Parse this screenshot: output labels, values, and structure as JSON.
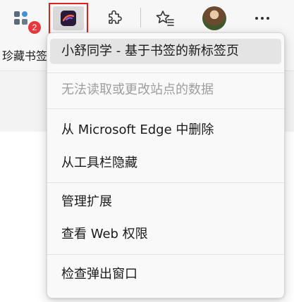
{
  "toolbar": {
    "apps_badge": "2",
    "accent": "#e02020"
  },
  "favorites_bar": {
    "item_label": "珍藏书签"
  },
  "menu": {
    "title": "小舒同学 - 基于书签的新标签页",
    "read_change_site_data": "无法读取或更改站点的数据",
    "remove_from_edge": "从 Microsoft Edge 中删除",
    "hide_from_toolbar": "从工具栏隐藏",
    "manage_extensions": "管理扩展",
    "view_web_permissions": "查看 Web 权限",
    "inspect_popup": "检查弹出窗口"
  }
}
